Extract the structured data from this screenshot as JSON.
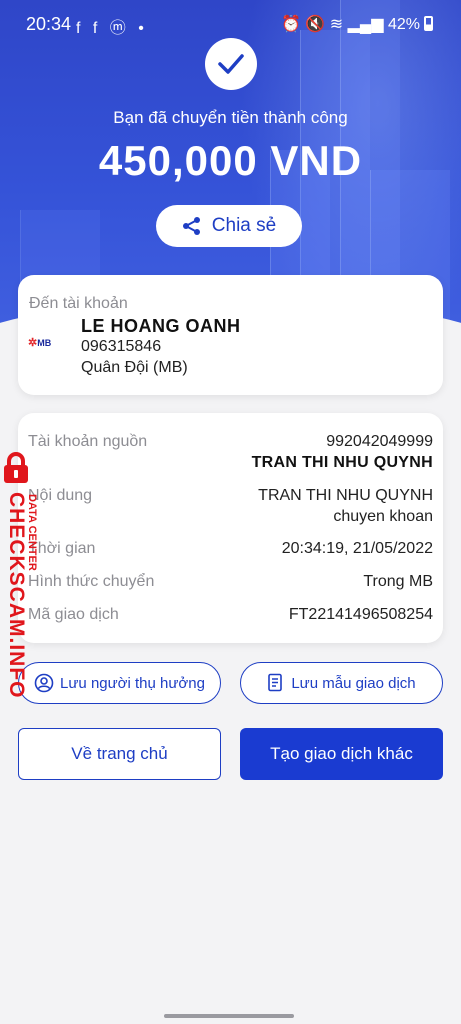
{
  "status_bar": {
    "time": "20:34",
    "apps": "f f ⓜ •",
    "battery": "42%"
  },
  "hero": {
    "subtitle": "Bạn đã chuyển tiền thành công",
    "amount": "450,000 VND",
    "share_label": "Chia sẻ"
  },
  "destination": {
    "label": "Đến tài khoản",
    "bank_logo": "MB",
    "name": "LE HOANG OANH",
    "account": "096315846",
    "bank": "Quân Đội (MB)"
  },
  "details": {
    "source_label": "Tài khoản nguồn",
    "source_account": "992042049999",
    "source_name": "TRAN THI NHU QUYNH",
    "content_label": "Nội dung",
    "content_line1": "TRAN THI NHU QUYNH",
    "content_line2": "chuyen khoan",
    "time_label": "Thời gian",
    "time_value": "20:34:19, 21/05/2022",
    "method_label": "Hình thức chuyển",
    "method_value": "Trong MB",
    "txn_label": "Mã giao dịch",
    "txn_value": "FT22141496508254"
  },
  "actions": {
    "save_beneficiary": "Lưu người thụ hưởng",
    "save_template": "Lưu mẫu giao dịch",
    "home": "Về trang chủ",
    "new_transaction": "Tạo giao dịch khác"
  },
  "watermark": {
    "main": "CHECKSCAM.INFO",
    "sub": "DATA CENTER"
  },
  "colors": {
    "brand": "#1a3bd1",
    "hero": "#3553d8",
    "watermark": "#e0161c"
  }
}
